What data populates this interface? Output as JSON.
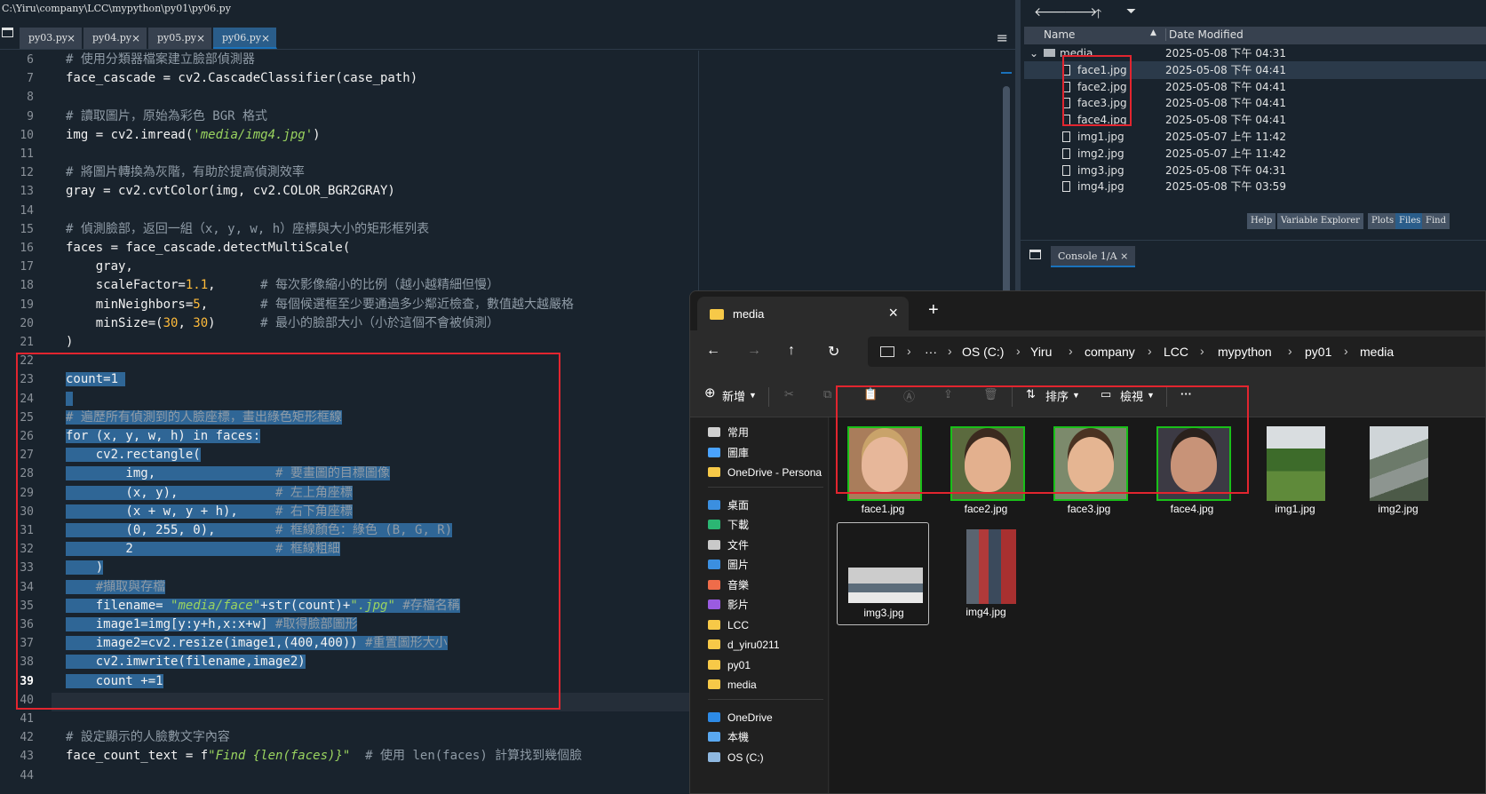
{
  "editor": {
    "title_path": "C:\\Yiru\\company\\LCC\\mypython\\py01\\py06.py",
    "tabs": [
      {
        "label": "py03.py"
      },
      {
        "label": "py04.py"
      },
      {
        "label": "py05.py"
      },
      {
        "label": "py06.py",
        "active": true
      }
    ],
    "current_line": 39,
    "lines": [
      {
        "n": 6,
        "text": "# 使用分類器檔案建立臉部偵測器"
      },
      {
        "n": 7,
        "text": "face_cascade = cv2.CascadeClassifier(case_path)"
      },
      {
        "n": 8,
        "text": ""
      },
      {
        "n": 9,
        "text": "# 讀取圖片，原始為彩色 BGR 格式"
      },
      {
        "n": 10,
        "text": "img = cv2.imread('media/img4.jpg')"
      },
      {
        "n": 11,
        "text": ""
      },
      {
        "n": 12,
        "text": "# 將圖片轉換為灰階，有助於提高偵測效率"
      },
      {
        "n": 13,
        "text": "gray = cv2.cvtColor(img, cv2.COLOR_BGR2GRAY)"
      },
      {
        "n": 14,
        "text": ""
      },
      {
        "n": 15,
        "text": "# 偵測臉部，返回一組（x, y, w, h）座標與大小的矩形框列表"
      },
      {
        "n": 16,
        "text": "faces = face_cascade.detectMultiScale("
      },
      {
        "n": 17,
        "text": "    gray,"
      },
      {
        "n": 18,
        "text": "    scaleFactor=1.1,      # 每次影像縮小的比例（越小越精細但慢）"
      },
      {
        "n": 19,
        "text": "    minNeighbors=5,       # 每個候選框至少要通過多少鄰近檢查，數值越大越嚴格"
      },
      {
        "n": 20,
        "text": "    minSize=(30, 30)      # 最小的臉部大小（小於這個不會被偵測）"
      },
      {
        "n": 21,
        "text": ")"
      },
      {
        "n": 22,
        "text": ""
      },
      {
        "n": 23,
        "text": "count=1 "
      },
      {
        "n": 24,
        "text": ""
      },
      {
        "n": 25,
        "text": "# 遍歷所有偵測到的人臉座標，畫出綠色矩形框線"
      },
      {
        "n": 26,
        "text": "for (x, y, w, h) in faces:"
      },
      {
        "n": 27,
        "text": "    cv2.rectangle("
      },
      {
        "n": 28,
        "text": "        img,                # 要畫圖的目標圖像"
      },
      {
        "n": 29,
        "text": "        (x, y),             # 左上角座標"
      },
      {
        "n": 30,
        "text": "        (x + w, y + h),     # 右下角座標"
      },
      {
        "n": 31,
        "text": "        (0, 255, 0),        # 框線顏色：綠色 (B, G, R)"
      },
      {
        "n": 32,
        "text": "        2                   # 框線粗細"
      },
      {
        "n": 33,
        "text": "    )"
      },
      {
        "n": 34,
        "text": "    #擷取與存檔"
      },
      {
        "n": 35,
        "text": "    filename= \"media/face\"+str(count)+\".jpg\" #存檔名稱"
      },
      {
        "n": 36,
        "text": "    image1=img[y:y+h,x:x+w] #取得臉部圖形"
      },
      {
        "n": 37,
        "text": "    image2=cv2.resize(image1,(400,400)) #重置圖形大小"
      },
      {
        "n": 38,
        "text": "    cv2.imwrite(filename,image2)"
      },
      {
        "n": 39,
        "text": "    count +=1"
      },
      {
        "n": 40,
        "text": ""
      },
      {
        "n": 41,
        "text": ""
      },
      {
        "n": 42,
        "text": "# 設定顯示的人臉數文字內容"
      },
      {
        "n": 43,
        "text": "face_count_text = f\"Find {len(faces)}\"  # 使用 len(faces) 計算找到幾個臉"
      },
      {
        "n": 44,
        "text": ""
      }
    ]
  },
  "files_pane": {
    "header": {
      "name": "Name",
      "date": "Date Modified"
    },
    "rows": [
      {
        "name": "media",
        "date": "2025-05-08 下午 04:31",
        "folder": true
      },
      {
        "name": "face1.jpg",
        "date": "2025-05-08 下午 04:41"
      },
      {
        "name": "face2.jpg",
        "date": "2025-05-08 下午 04:41"
      },
      {
        "name": "face3.jpg",
        "date": "2025-05-08 下午 04:41"
      },
      {
        "name": "face4.jpg",
        "date": "2025-05-08 下午 04:41"
      },
      {
        "name": "img1.jpg",
        "date": "2025-05-07 上午 11:42"
      },
      {
        "name": "img2.jpg",
        "date": "2025-05-07 上午 11:42"
      },
      {
        "name": "img3.jpg",
        "date": "2025-05-08 下午 04:31"
      },
      {
        "name": "img4.jpg",
        "date": "2025-05-08 下午 03:59"
      }
    ],
    "tabs": [
      "Help",
      "Variable Explorer",
      "Plots",
      "Files",
      "Find"
    ],
    "active_tab": "Files"
  },
  "console": {
    "tab_label": "Console 1/A"
  },
  "explorer": {
    "tab_label": "media",
    "breadcrumb": [
      "OS (C:)",
      "Yiru",
      "company",
      "LCC",
      "mypython",
      "py01",
      "media"
    ],
    "toolbar": {
      "new_label": "新增",
      "sort_label": "排序",
      "view_label": "檢視",
      "more_label": "···"
    },
    "sidebar": {
      "group1": [
        {
          "label": "常用",
          "icon": "home-icon"
        },
        {
          "label": "圖庫",
          "icon": "gallery-icon"
        },
        {
          "label": "OneDrive - Persona",
          "icon": "folder-icon"
        }
      ],
      "group2": [
        {
          "label": "桌面",
          "icon": "desktop-icon"
        },
        {
          "label": "下載",
          "icon": "download-icon"
        },
        {
          "label": "文件",
          "icon": "documents-icon"
        },
        {
          "label": "圖片",
          "icon": "pictures-icon"
        },
        {
          "label": "音樂",
          "icon": "music-icon"
        },
        {
          "label": "影片",
          "icon": "videos-icon"
        },
        {
          "label": "LCC",
          "icon": "folder-icon"
        },
        {
          "label": "d_yiru0211",
          "icon": "folder-icon"
        },
        {
          "label": "py01",
          "icon": "folder-icon"
        },
        {
          "label": "media",
          "icon": "folder-icon"
        }
      ],
      "group3": [
        {
          "label": "OneDrive",
          "icon": "cloud-icon"
        },
        {
          "label": "本機",
          "icon": "pc-icon"
        },
        {
          "label": "OS (C:)",
          "icon": "drive-icon"
        }
      ]
    },
    "files": [
      {
        "name": "face1.jpg"
      },
      {
        "name": "face2.jpg"
      },
      {
        "name": "face3.jpg"
      },
      {
        "name": "face4.jpg"
      },
      {
        "name": "img1.jpg"
      },
      {
        "name": "img2.jpg"
      },
      {
        "name": "img3.jpg",
        "selected": true
      },
      {
        "name": "img4.jpg"
      }
    ]
  }
}
